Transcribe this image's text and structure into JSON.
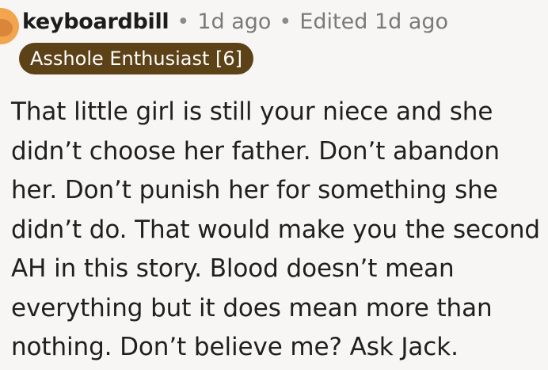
{
  "comment": {
    "author": "keyboardbill",
    "separator": "•",
    "age": "1d ago",
    "edited": "Edited 1d ago",
    "flair": "Asshole Enthusiast [6]",
    "body": "That little girl is still your niece and she didn’t choose her father. Don’t abandon her. Don’t punish her for something she didn’t do. That would make you the second AH in this story. Blood doesn’t mean everything but it does mean more than nothing. Don’t believe me? Ask Jack."
  },
  "colors": {
    "background": "#f8f6f4",
    "flair_background": "#5d4217",
    "avatar": "#f2a54d",
    "text": "#1f1f1f",
    "meta_text": "#7a7a7a"
  }
}
